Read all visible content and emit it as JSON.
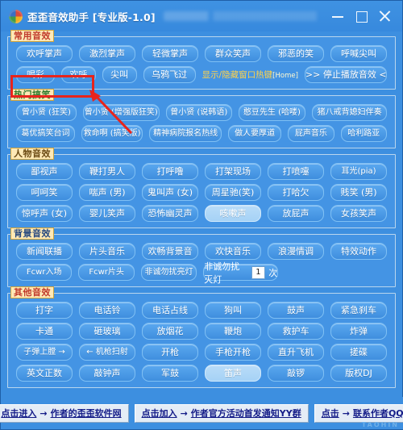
{
  "window": {
    "title": "歪歪音效助手 [专业版-1.0]",
    "logo_icon": "colored-pinwheel-icon",
    "controls": {
      "minimize": "minimize-icon",
      "maximize": "maximize-icon",
      "close": "close-icon"
    }
  },
  "groups": [
    {
      "label": "常用音效",
      "rows": [
        {
          "buttons": [
            "欢呼掌声",
            "激烈掌声",
            "轻微掌声",
            "群众笑声",
            "邪恶的笑",
            "呼喊尖叫"
          ]
        },
        {
          "buttons": [
            "喝彩",
            "欢呼",
            "尖叫",
            "乌鸦飞过"
          ],
          "hotkey_label": "显示/隐藏窗口热键",
          "hotkey_key": "[Home]",
          "stop_button": ">> 停止播放音效 <<"
        }
      ]
    },
    {
      "label": "热门搞笑",
      "rows": [
        {
          "buttons": [
            "曾小贤 (狂笑)",
            "曾小贤 (增强版狂笑)",
            "曾小贤 (说韩语)",
            "憨豆先生 (哈喽)",
            "猪八戒背媳妇伴奏"
          ]
        },
        {
          "buttons": [
            "葛优搞笑台词",
            "救命啊 (搞笑版)",
            "精神病院报名热线",
            "做人要厚道",
            "屁声音乐",
            "哈利路亚"
          ]
        }
      ]
    },
    {
      "label": "人物音效",
      "rows": [
        {
          "buttons": [
            "鄙视声",
            "鞭打男人",
            "打呼噜",
            "打架现场",
            "打喷嚏",
            "耳光(pia)"
          ]
        },
        {
          "buttons": [
            "呵呵笑",
            "喘声 (男)",
            "鬼叫声 (女)",
            "周星驰(笑)",
            "打哈欠",
            "贱笑 (男)"
          ]
        },
        {
          "buttons": [
            "惊呼声 (女)",
            "婴儿笑声",
            "恐怖幽灵声",
            "咳嗽声",
            "放屁声",
            "女孩笑声"
          ]
        }
      ]
    },
    {
      "label": "背景音效",
      "rows": [
        {
          "buttons": [
            "新闻联播",
            "片头音乐",
            "欢畅背景音",
            "欢快音乐",
            "浪漫情调",
            "特效动作"
          ]
        },
        {
          "buttons": [
            "Fcwr入场",
            "Fcwr片头",
            "非诚勿扰亮灯"
          ],
          "spin": {
            "prefix": "非诚勿扰灭灯",
            "value": "1",
            "suffix": "次"
          }
        }
      ]
    },
    {
      "label": "其他音效",
      "rows": [
        {
          "buttons": [
            "打字",
            "电话铃",
            "电话占线",
            "狗叫",
            "鼓声",
            "紧急刹车"
          ]
        },
        {
          "buttons": [
            "卡通",
            "砸玻璃",
            "放烟花",
            "鞭炮",
            "救护车",
            "炸弹"
          ]
        },
        {
          "buttons": [
            "子弹上膛 →",
            "← 机枪扫射",
            "开枪",
            "手枪开枪",
            "直升飞机",
            "搓碟"
          ]
        },
        {
          "buttons": [
            "英文正数",
            "敲钟声",
            "军鼓",
            "笛声",
            "敲锣",
            "版权DJ"
          ]
        }
      ]
    }
  ],
  "footer": {
    "buttons": [
      {
        "lead": "点击进入",
        "arrow": "→",
        "text": "作者的歪歪软件网"
      },
      {
        "lead": "点击加入",
        "arrow": "→",
        "text": "作者官方活动首发通知YY群"
      },
      {
        "lead": "点击",
        "arrow": "→",
        "text": "联系作者QQ"
      }
    ],
    "watermark": "TAOHIN"
  },
  "annotation": {
    "highlight_target": "欢呼掌声",
    "highlight_color": "#e8241c"
  }
}
